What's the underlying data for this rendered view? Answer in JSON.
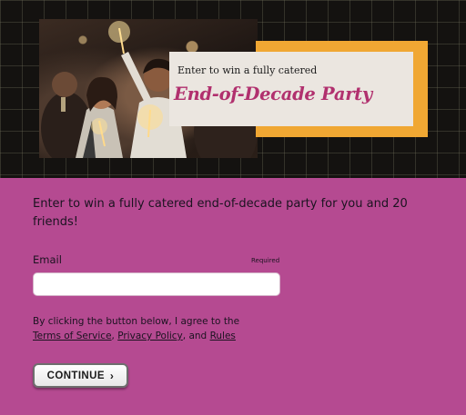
{
  "hero": {
    "kicker": "Enter to win a fully catered",
    "headline": "End-of-Decade Party",
    "colors": {
      "panel": "#f0a733",
      "headline": "#b1306e",
      "background": "#141210"
    }
  },
  "form": {
    "intro": "Enter to win a fully catered end-of-decade party for you and 20 friends!",
    "email_label": "Email",
    "required_label": "Required",
    "email_value": "",
    "legal_prefix": "By clicking the button below, I agree to the",
    "terms_link": "Terms of Service",
    "sep1": ", ",
    "privacy_link": "Privacy Policy",
    "sep2": ", and ",
    "rules_link": "Rules",
    "continue_label": "CONTINUE",
    "continue_icon": "chevron-right-icon"
  },
  "colors": {
    "page_background": "#b54a91"
  }
}
